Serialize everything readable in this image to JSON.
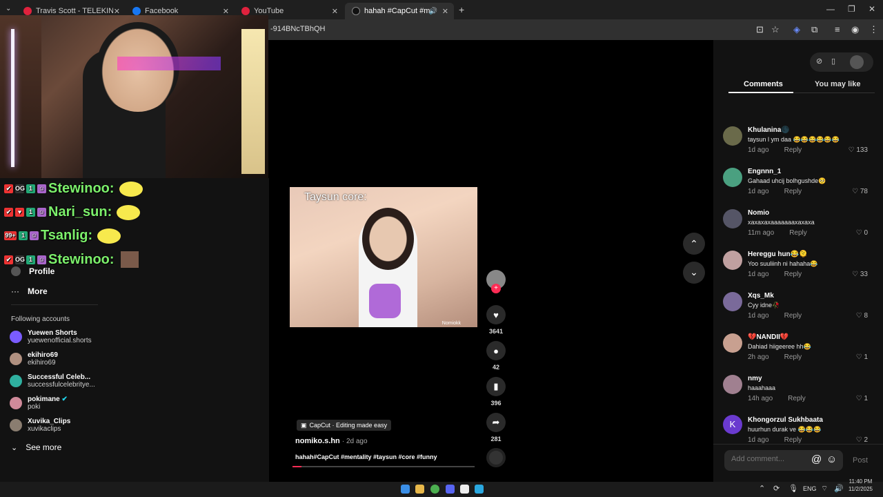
{
  "browser": {
    "tabs": [
      {
        "label": "Travis Scott - TELEKINESIS (Offi",
        "color": "#e0223d"
      },
      {
        "label": "Facebook",
        "color": "#1877f2"
      },
      {
        "label": "YouTube",
        "color": "#e0223d"
      },
      {
        "label": "hahah #CapCut #mentality",
        "color": "#111111"
      }
    ],
    "url": "-914BNcTBhQH"
  },
  "chat": [
    {
      "badge1": "OG",
      "name": "Stewinoo:"
    },
    {
      "badge1": "♥",
      "name": "Nari_sun:"
    },
    {
      "badge1": "99+",
      "name": "Tsanlig:"
    },
    {
      "badge1": "OG",
      "name": "Stewinoo:"
    }
  ],
  "nav": {
    "profile": "Profile",
    "more": "More",
    "following_header": "Following accounts",
    "following": [
      {
        "name": "Yuewen Shorts",
        "sub": "yuewenofficial.shorts",
        "color": "#7a5cff"
      },
      {
        "name": "ekihiro69",
        "sub": "ekihiro69",
        "color": "#b09080"
      },
      {
        "name": "Successful Celeb...",
        "sub": "successfulcelebritye...",
        "color": "#2fb0a0"
      },
      {
        "name": "pokimane",
        "sub": "poki",
        "color": "#d08a9a"
      },
      {
        "name": "Xuvika_Clips",
        "sub": "xuvikaclips",
        "color": "#8a7d70"
      }
    ],
    "see_more": "See more"
  },
  "video": {
    "caption": "Taysun core:",
    "watermark": "Nomiokk",
    "capcut": "CapCut · Editing made easy",
    "author": "nomiko.s.hn",
    "age": "· 2d ago",
    "description": "hahah#CapCut #mentality #taysun #core #funny",
    "likes": "3641",
    "comments": "42",
    "saves": "396",
    "shares": "281"
  },
  "panel": {
    "tab_comments": "Comments",
    "tab_you_may_like": "You may like",
    "add_comment_placeholder": "Add comment...",
    "post": "Post",
    "reply": "Reply"
  },
  "comments": [
    {
      "user": "Khulanina🌑",
      "text": "taysun l ym daa 😂😂😂😂😂😂",
      "age": "1d ago",
      "likes": "133",
      "color": "#6a6a4a"
    },
    {
      "user": "Engnnn_1",
      "text": "Gahaad uhcij bolhgushde🥺",
      "age": "1d ago",
      "likes": "78",
      "color": "#4aa080"
    },
    {
      "user": "Nomio",
      "text": "xaxaxaxaaaaaaaxaxaxa",
      "age": "11m ago",
      "likes": "0",
      "color": "#555566"
    },
    {
      "user": "Hereggu hun😂🫠",
      "text": "Yoo suuliinh ni hahaha😂",
      "age": "1d ago",
      "likes": "33",
      "color": "#c0a0a0"
    },
    {
      "user": "Xqs_Mk",
      "text": "Cyy idne🥀",
      "age": "1d ago",
      "likes": "8",
      "color": "#7a6a9a"
    },
    {
      "user": "💔NANDII💔",
      "text": "Dahiad hiigeeree hh😂",
      "age": "2h ago",
      "likes": "1",
      "color": "#c8a090"
    },
    {
      "user": "nmy",
      "text": "haaahaaa",
      "age": "14h ago",
      "likes": "1",
      "color": "#a08090"
    },
    {
      "user": "Khongorzul Sukhbaata",
      "text": "huurhun durak ve 😂😂😂",
      "age": "1d ago",
      "likes": "2",
      "color": "#6a3acf",
      "initial": "K"
    }
  ],
  "taskbar": {
    "lang": "ENG",
    "time": "11:40 PM",
    "date": "11/2/2025"
  }
}
